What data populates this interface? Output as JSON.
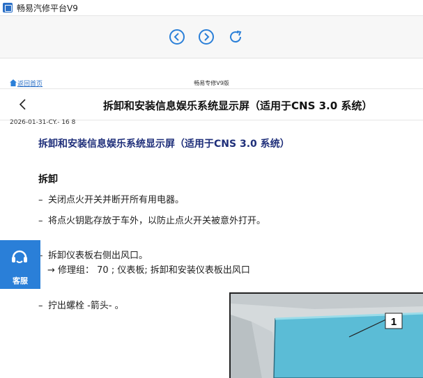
{
  "window": {
    "title": "畅易汽修平台V9"
  },
  "nav": {
    "back_icon": "chevron-left-circle-icon",
    "forward_icon": "chevron-right-circle-icon",
    "reload_icon": "reload-icon"
  },
  "header": {
    "home_link": "返回首页",
    "brand": "畅易专修V9版"
  },
  "document": {
    "title": "拆卸和安装信息娱乐系统显示屏（适用于CNS 3.0 系统）",
    "date": "2026-01-31-CY.- 16 8",
    "heading": "拆卸和安装信息娱乐系统显示屏（适用于CNS 3.0 系统）",
    "section": "拆卸",
    "steps": [
      {
        "dash": "–",
        "text": "关闭点火开关并断开所有用电器。"
      },
      {
        "dash": "–",
        "text": "将点火钥匙存放于车外，以防止点火开关被意外打开。"
      },
      {
        "dash": "–",
        "text": "拆卸仪表板右侧出风口。"
      },
      {
        "dash": "–",
        "text": "拧出螺栓 -箭头- 。"
      }
    ],
    "reference": "→  修理组： 70 ; 仪表板; 拆卸和安装仪表板出风口"
  },
  "service": {
    "label": "客服"
  },
  "figure": {
    "callout": "1"
  },
  "colors": {
    "accent": "#2a7fd8",
    "heading": "#1f2f7a",
    "panel": "#5bbcd6"
  }
}
